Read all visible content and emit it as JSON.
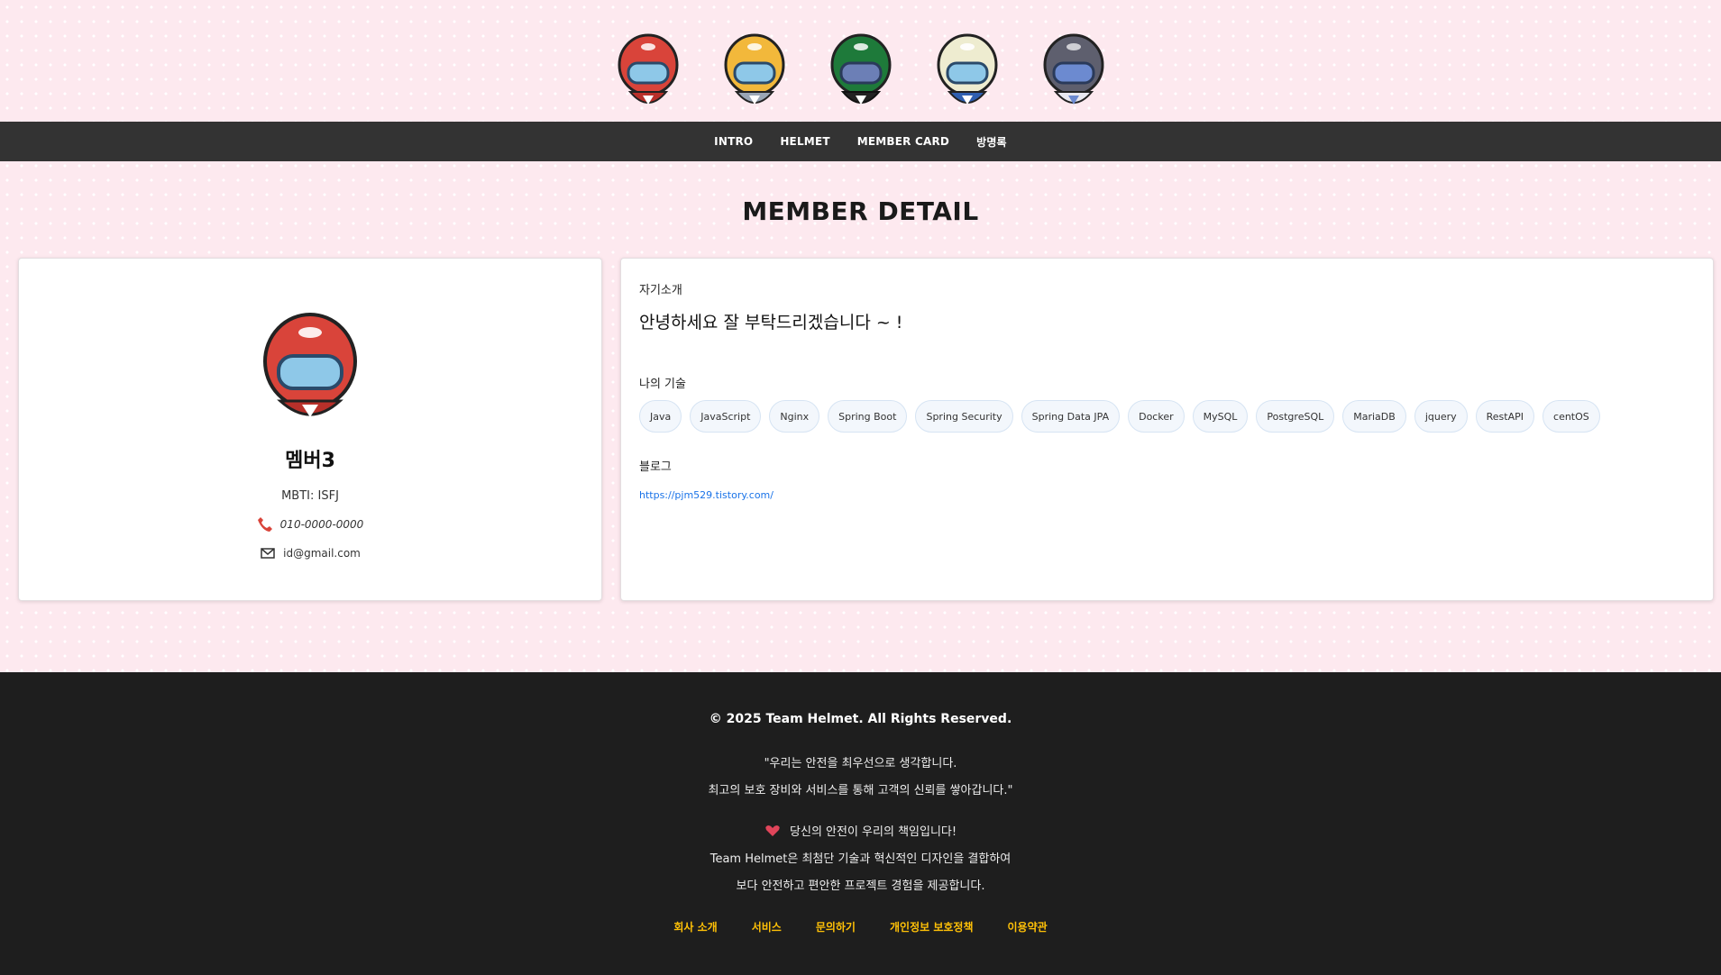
{
  "header": {
    "helmets": [
      {
        "name": "red-helmet",
        "color": "#d9443a"
      },
      {
        "name": "yellow-helmet",
        "color": "#f2b83b"
      },
      {
        "name": "green-helmet",
        "color": "#1e7a3a"
      },
      {
        "name": "cream-helmet",
        "color": "#eeecd0"
      },
      {
        "name": "gray-helmet",
        "color": "#5e5f6e"
      }
    ]
  },
  "nav": {
    "items": [
      "INTRO",
      "HELMET",
      "MEMBER CARD",
      "방명록"
    ]
  },
  "page": {
    "title": "MEMBER DETAIL"
  },
  "profile": {
    "name": "멤버3",
    "mbti": "MBTI: ISFJ",
    "phone": "010-0000-0000",
    "email": "id@gmail.com",
    "avatar_color": "#d9443a"
  },
  "detail": {
    "intro_label": "자기소개",
    "intro_text": "안녕하세요 잘 부탁드리겠습니다 ~ !",
    "skills_label": "나의 기술",
    "skills": [
      "Java",
      "JavaScript",
      "Nginx",
      "Spring Boot",
      "Spring Security",
      "Spring Data JPA",
      "Docker",
      "MySQL",
      "PostgreSQL",
      "MariaDB",
      "jquery",
      "RestAPI",
      "centOS"
    ],
    "blog_label": "블로그",
    "blog_url": "https://pjm529.tistory.com/"
  },
  "footer": {
    "copyright": "© 2025 Team Helmet. All Rights Reserved.",
    "quote_line1": "\"우리는 안전을 최우선으로 생각합니다.",
    "quote_line2": "최고의 보호 장비와 서비스를 통해 고객의 신뢰를 쌓아갑니다.\"",
    "mission_line1": "당신의 안전이 우리의 책임입니다!",
    "mission_line2": "Team Helmet은 최첨단 기술과 혁신적인 디자인을 결합하여",
    "mission_line3": "보다 안전하고 편안한 프로젝트 경험을 제공합니다.",
    "links": [
      "회사 소개",
      "서비스",
      "문의하기",
      "개인정보 보호정책",
      "이용약관"
    ],
    "accent_color": "#ffc107"
  }
}
